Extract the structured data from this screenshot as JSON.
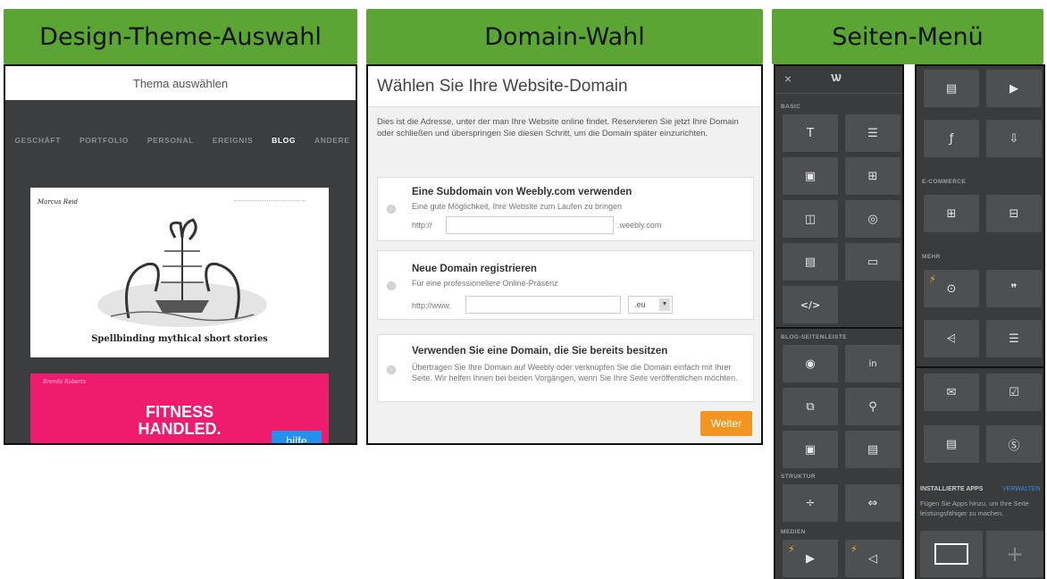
{
  "headers": {
    "design": "Design-Theme-Auswahl",
    "domain": "Domain-Wahl",
    "menu": "Seiten-Menü"
  },
  "theme": {
    "topbar_title": "Thema auswählen",
    "categories": [
      "GESCHÄFT",
      "PORTFOLIO",
      "PERSONAL",
      "EREIGNIS",
      "BLOG",
      "ANDERE"
    ],
    "active_category": "BLOG",
    "card1_author": "Marcus Reid",
    "card1_caption": "Spellbinding mythical short stories",
    "card2_author": "Brenda Roberts",
    "card2_headline_1": "FITNESS",
    "card2_headline_2": "HANDLED.",
    "help_label": "hilfe"
  },
  "domain": {
    "title": "Wählen Sie Ihre Website-Domain",
    "intro": "Dies ist die Adresse, unter der man Ihre Website online findet. Reservieren Sie jetzt Ihre Domain oder schließen und überspringen Sie diesen Schritt, um die Domain später einzurichten.",
    "option1_title": "Eine Subdomain von Weebly.com verwenden",
    "option1_sub": "Eine gute Möglichkeit, Ihre Website zum Laufen zu bringen",
    "option1_prefix": "http://",
    "option1_suffix": ".weebly.com",
    "option2_title": "Neue Domain registrieren",
    "option2_sub": "Für eine professionellere Online-Präsenz",
    "option2_prefix": "http://www.",
    "option2_tld": ".eu",
    "option3_title": "Verwenden Sie eine Domain, die Sie bereits besitzen",
    "option3_sub": "Übertragen Sie Ihre Domain auf Weebly oder verknüpfen Sie die Domain einfach mit Ihrer Seite. Wir helfen Ihnen bei beiden Vorgängen, wenn Sie Ihre Seite veröffentlichen möchten.",
    "continue_label": "Weiter"
  },
  "menu": {
    "close_glyph": "×",
    "logo_glyph": "ѡ",
    "sec_basic": "BASIC",
    "sec_blog": "BLOG-SEITENLEISTE",
    "sec_struktur": "STRUKTUR",
    "sec_medien": "MEDIEN",
    "sec_ecommerce": "E-COMMERCE",
    "sec_mehr": "MEHR",
    "sec_apps": "INSTALLIERTE APPS",
    "apps_manage": "VERWALTEN",
    "apps_text": "Fügen Sie Apps hinzu, um Ihre Seite leistungsfähiger zu machen.",
    "add_glyph": "+",
    "glyphs": {
      "title": "T",
      "text": "☰",
      "image": "▣",
      "gallery": "⊞",
      "slideshow": "◫",
      "map": "◎",
      "image_text": "▤",
      "button": "▭",
      "code": "</>",
      "flickr": "◉",
      "linkedin": "in",
      "archive": "⧉",
      "badge": "⚲",
      "categories": "▣",
      "posts": "▤",
      "divider": "÷",
      "spacer": "⇔",
      "video": "▶",
      "audio": "◁",
      "document": "▤",
      "youtube": "▶",
      "flash": "ƒ",
      "file": "⇩",
      "product": "⊞",
      "store": "⊟",
      "search": "⊙",
      "quote": "❞",
      "social": "⩤",
      "form": "☰",
      "email": "✉",
      "survey": "☑",
      "contact": "▤",
      "rss": "Ⓢ"
    }
  }
}
